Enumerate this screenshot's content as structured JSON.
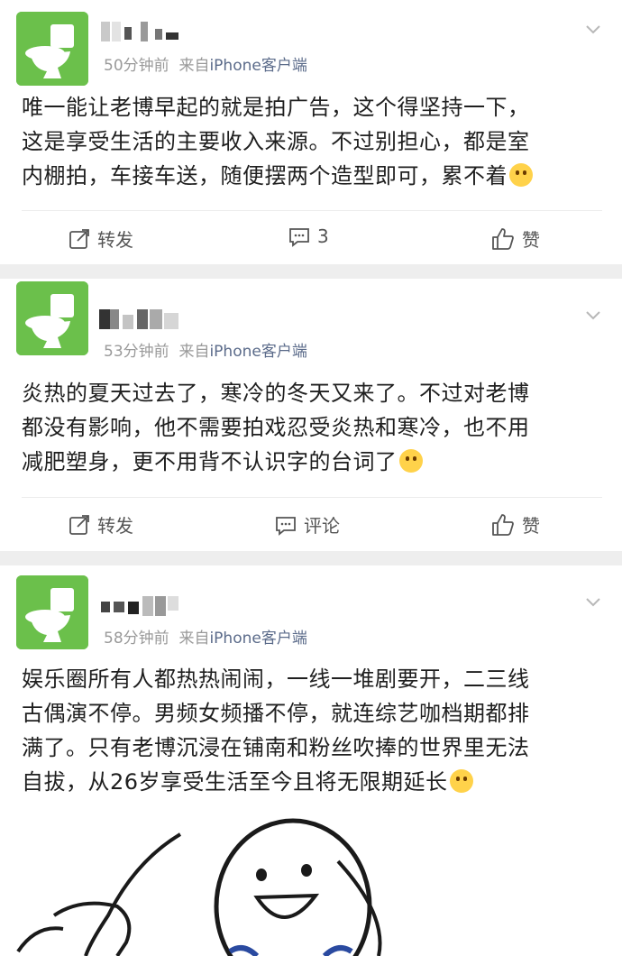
{
  "colors": {
    "accent_green": "#6bc04b",
    "meta_gray": "#9a9a9a",
    "source_blue": "#5b6b8a",
    "separator": "#eeeeee"
  },
  "posts": [
    {
      "time": "50分钟前",
      "from": "来自",
      "source": "iPhone客户端",
      "lines": [
        "唯一能让老博早起的就是拍广告，这个得坚持一下，",
        "这是享受生活的主要收入来源。不过别担心，都是室",
        "内棚拍，车接车送，随便摆两个造型即可，累不着"
      ],
      "emoji": "shocked-face-emoji",
      "repost_label": "转发",
      "comment_label": "3",
      "like_label": "赞"
    },
    {
      "time": "53分钟前",
      "from": "来自",
      "source": "iPhone客户端",
      "lines": [
        "炎热的夏天过去了，寒冷的冬天又来了。不过对老博",
        "都没有影响，他不需要拍戏忍受炎热和寒冷，也不用",
        "减肥塑身，更不用背不认识字的台词了"
      ],
      "emoji": "hands-over-mouth-emoji",
      "repost_label": "转发",
      "comment_label": "评论",
      "like_label": "赞"
    },
    {
      "time": "58分钟前",
      "from": "来自",
      "source": "iPhone客户端",
      "lines": [
        "娱乐圈所有人都热热闹闹，一线一堆剧要开，二三线",
        "古偶演不停。男频女频播不停，就连综艺咖档期都排",
        "满了。只有老博沉浸在铺南和粉丝吹捧的世界里无法",
        "自拔，从26岁享受生活至今且将无限期延长"
      ],
      "emoji": "smile-emoji"
    }
  ],
  "icons": {
    "avatar": "toilet-icon",
    "more": "chevron-down-icon",
    "repost": "repost-icon",
    "comment": "comment-icon",
    "like": "thumbs-up-icon"
  }
}
